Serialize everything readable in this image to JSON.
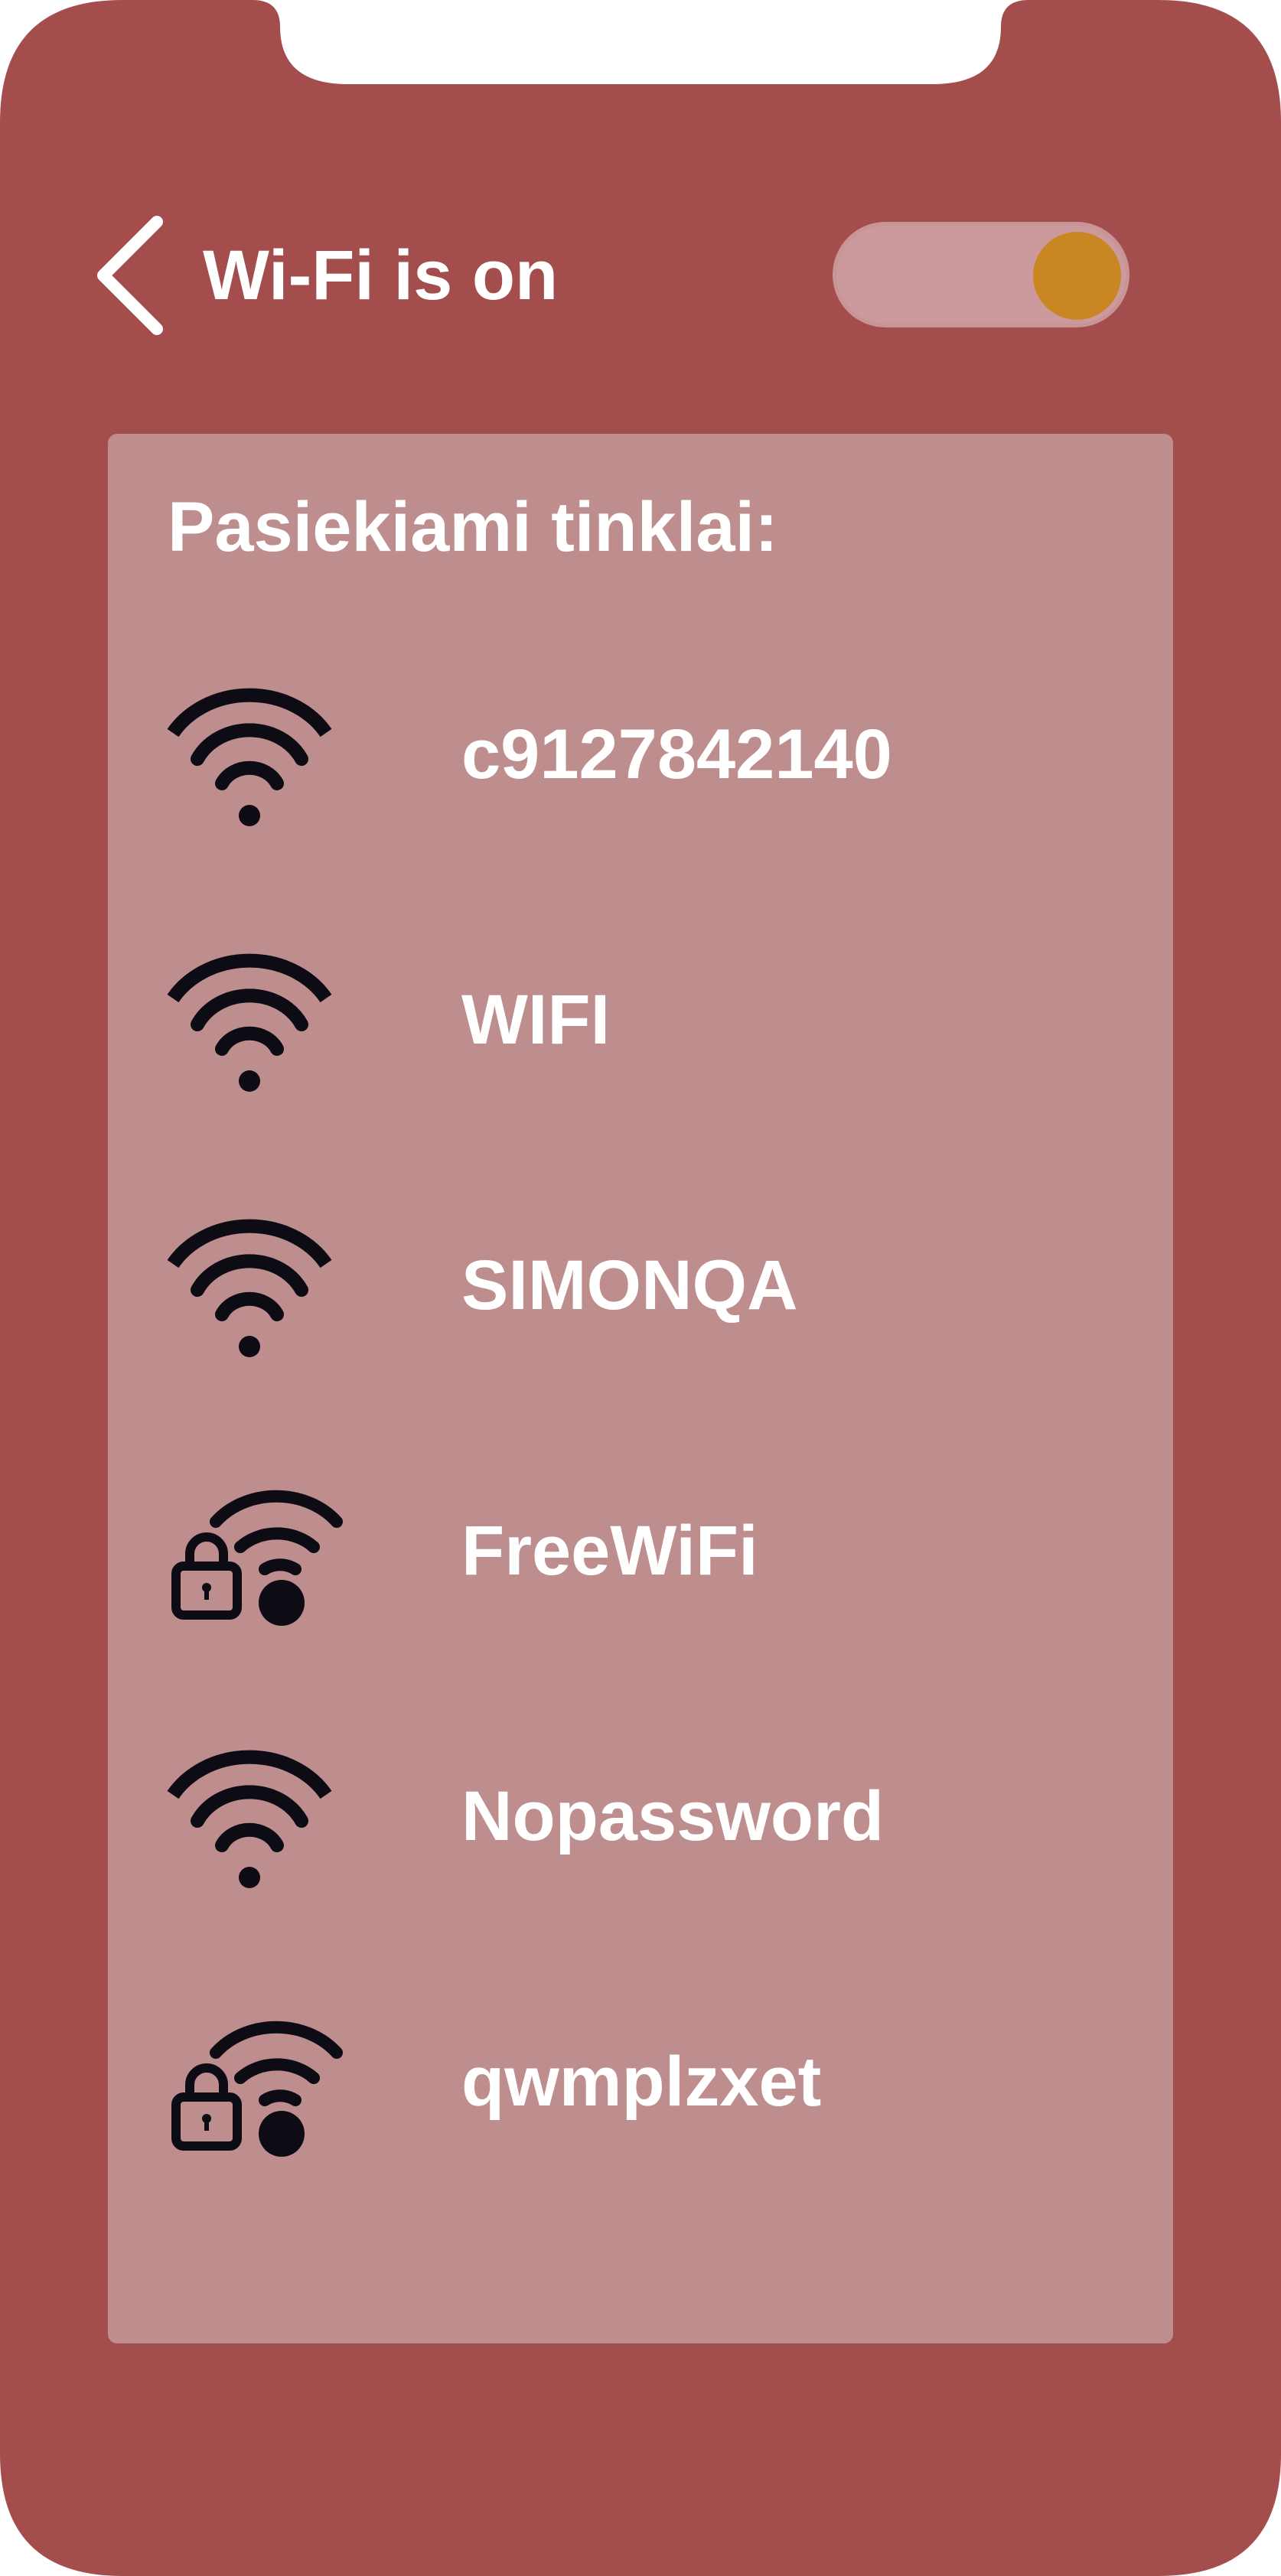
{
  "header": {
    "title": "Wi-Fi is on",
    "wifi_enabled": true,
    "back_icon": "chevron-left-icon"
  },
  "list": {
    "heading": "Pasiekiami tinklai:",
    "networks": [
      {
        "name": "c9127842140",
        "icon": "wifi-icon",
        "locked": false
      },
      {
        "name": "WIFI",
        "icon": "wifi-icon",
        "locked": false
      },
      {
        "name": "SIMONQA",
        "icon": "wifi-icon",
        "locked": false
      },
      {
        "name": "FreeWiFi",
        "icon": "wifi-lock-icon",
        "locked": true
      },
      {
        "name": "Nopassword",
        "icon": "wifi-icon",
        "locked": false
      },
      {
        "name": "qwmplzxet",
        "icon": "wifi-lock-icon",
        "locked": true
      }
    ]
  },
  "colors": {
    "phone_body": "#a34d4d",
    "panel": "#be8d8e",
    "toggle_track": "#cc9a9d",
    "toggle_knob": "#c98723",
    "text": "#ffffff",
    "icon": "#0d0b14"
  }
}
